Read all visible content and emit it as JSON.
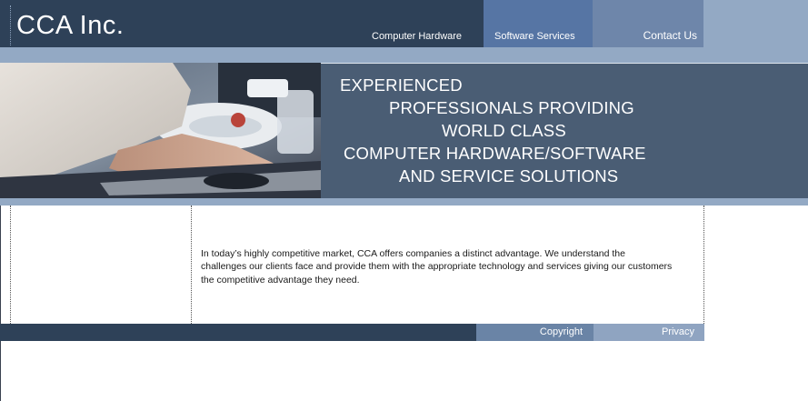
{
  "header": {
    "logo": "CCA Inc.",
    "nav": [
      {
        "label": "Computer Hardware"
      },
      {
        "label": "Software Services"
      },
      {
        "label": "Contact Us"
      }
    ]
  },
  "hero": {
    "image_description_icon": "hands-on-keyboard-photo",
    "tagline_lines": [
      "EXPERIENCED",
      "PROFESSIONALS PROVIDING",
      "WORLD CLASS",
      "COMPUTER HARDWARE/SOFTWARE",
      "AND SERVICE SOLUTIONS"
    ]
  },
  "content": {
    "intro": "In today’s highly competitive market, CCA offers companies a distinct advantage. We understand the challenges our clients face and provide them with the appropriate technology and services giving our customers the competitive advantage they need."
  },
  "footer": {
    "copyright": "Copyright",
    "privacy": "Privacy"
  },
  "colors": {
    "header_navy": "#2e4158",
    "hero_panel": "#4a5d74",
    "light_blue": "#93a9c4",
    "nav_active": "#5675a4",
    "nav_contact": "#6e86aa"
  }
}
